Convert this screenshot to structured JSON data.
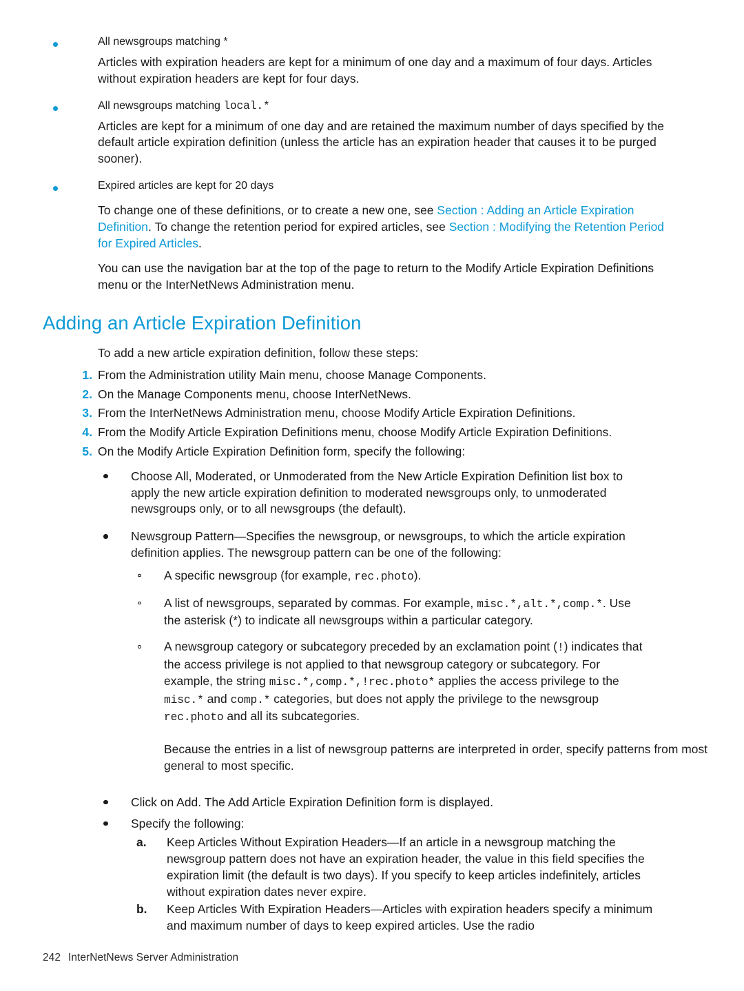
{
  "page": {
    "number": "242",
    "footer_title": "InterNetNews Server Administration",
    "accent_color": "#0c9ad6",
    "text_color": "#1a1a1a"
  },
  "intro": {
    "bullet1_label": "All newsgroups matching *",
    "bullet1_body": "Articles with expiration headers are kept for a minimum of one day and a maximum of four days. Articles without expiration headers are kept for four days.",
    "bullet2_prefix": "All newsgroups matching ",
    "bullet2_code": "local.*",
    "bullet2_body": "Articles are kept for a minimum of one day and are retained the maximum number of days specified by the default article expiration definition (unless the article has an expiration header that causes it to be purged sooner).",
    "bullet3_label": "Expired articles are kept for 20 days",
    "change_para_1": "To change one of these definitions, or to create a new one, see ",
    "link_1": "Section : Adding an Article Expiration Definition",
    "change_para_2": ". To change the retention period for expired articles, see ",
    "link_2": "Section : Modifying the Retention Period for Expired Articles",
    "change_para_3": ".",
    "nav_para": "You can use the navigation bar at the top of the page to return to the Modify Article Expiration Definitions menu or the InterNetNews Administration menu."
  },
  "section": {
    "heading": "Adding an Article Expiration Definition",
    "lead": "To add a new article expiration definition, follow these steps:",
    "steps": [
      {
        "num": "1.",
        "text": "From the Administration utility Main menu, choose Manage Components."
      },
      {
        "num": "2.",
        "text": "On the Manage Components menu, choose InterNetNews."
      },
      {
        "num": "3.",
        "text": "From the InterNetNews Administration menu, choose Modify Article Expiration Definitions."
      },
      {
        "num": "4.",
        "text": "From the Modify Article Expiration Definitions menu, choose Modify Article Expiration Definitions."
      },
      {
        "num": "5.",
        "text": "On the Modify Article Expiration Definition form, specify the following:"
      }
    ]
  },
  "step5": {
    "bullet_a": "Choose All, Moderated, or Unmoderated from the New Article Expiration Definition list box to apply the new article expiration definition to moderated newsgroups only, to unmoderated newsgroups only, or to all newsgroups (the default).",
    "bullet_b": "Newsgroup Pattern—Specifies the newsgroup, or newsgroups, to which the article expiration definition applies. The newsgroup pattern can be one of the following:",
    "sub": {
      "item1_pre": "A specific newsgroup (for example, ",
      "item1_code": "rec.photo",
      "item1_post": ").",
      "item2_pre": "A list of newsgroups, separated by commas. For example, ",
      "item2_code": "misc.*,alt.*,comp.*",
      "item2_post": ". Use the asterisk (*) to indicate all newsgroups within a particular category.",
      "item3_pre": "A newsgroup category or subcategory preceded by an exclamation point (",
      "item3_code1": "!",
      "item3_mid1": ") indicates that the access privilege is not applied to that newsgroup category or subcategory. For example, the string ",
      "item3_code2": "misc.*,comp.*,!rec.photo*",
      "item3_mid2": " applies the access privilege to the ",
      "item3_code3": "misc.*",
      "item3_mid3": " and ",
      "item3_code4": "comp.*",
      "item3_mid4": " categories, but does not apply the privilege to the newsgroup ",
      "item3_code5": "rec.photo",
      "item3_post": " and all its subcategories."
    },
    "order_note": "Because the entries in a list of newsgroup patterns are interpreted in order, specify patterns from most general to most specific.",
    "bullet_c": "Click on Add. The Add Article Expiration Definition form is displayed.",
    "bullet_d": "Specify the following:",
    "alpha": [
      {
        "letter": "a.",
        "text": "Keep Articles Without Expiration Headers—If an article in a newsgroup matching the newsgroup pattern does not have an expiration header, the value in this field specifies the expiration limit (the default is two days). If you specify to keep articles indefinitely, articles without expiration dates never expire."
      },
      {
        "letter": "b.",
        "text": "Keep Articles With Expiration Headers—Articles with expiration headers specify a minimum and maximum number of days to keep expired articles. Use the radio"
      }
    ]
  }
}
